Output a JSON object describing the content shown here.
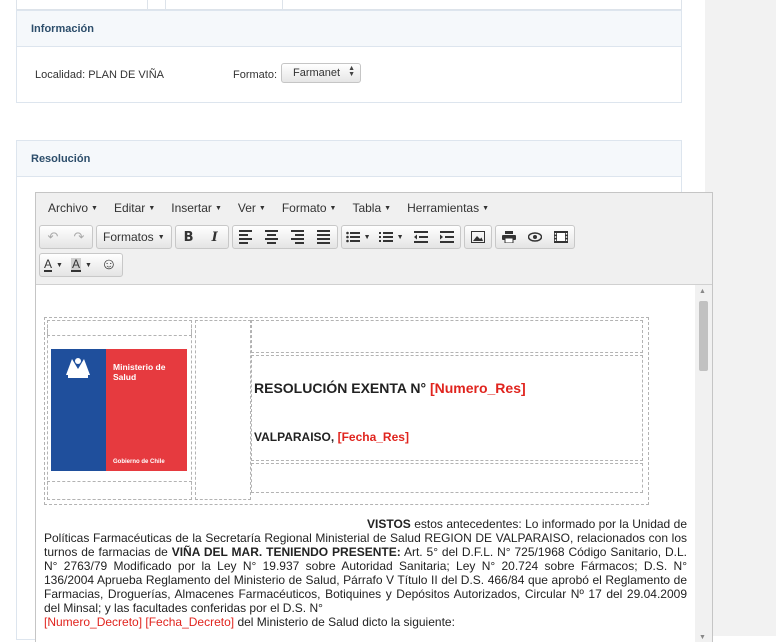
{
  "panels": {
    "informacion": {
      "title": "Información",
      "localidad": "Localidad: PLAN DE VIÑA",
      "formato_label": "Formato:",
      "formato_value": "Farmanet"
    },
    "resolucion": {
      "title": "Resolución"
    }
  },
  "editor": {
    "menu": [
      "Archivo",
      "Editar",
      "Insertar",
      "Ver",
      "Formato",
      "Tabla",
      "Herramientas"
    ],
    "formats_label": "Formatos",
    "icons": [
      "undo-icon",
      "redo-icon",
      "bold-icon",
      "italic-icon",
      "align-left-icon",
      "align-center-icon",
      "align-right-icon",
      "align-justify-icon",
      "bullet-list-icon",
      "numbered-list-icon",
      "outdent-icon",
      "indent-icon",
      "image-icon",
      "print-icon",
      "preview-icon",
      "media-icon",
      "text-color-icon",
      "background-color-icon",
      "emoticons-icon"
    ],
    "glyphs": {
      "undo": "↶",
      "redo": "↷",
      "bold": "B",
      "italic": "I",
      "text_color": "A",
      "bg_color": "A",
      "emoticon": "☺"
    }
  },
  "document": {
    "logo": {
      "ministerio": "Ministerio de Salud",
      "gobierno": "Gobierno de Chile"
    },
    "resolucion_label": "RESOLUCIÓN EXENTA N°",
    "numero_res_placeholder": "[Numero_Res]",
    "city": "VALPARAISO,",
    "fecha_res_placeholder": "[Fecha_Res]",
    "vistos_label": "VISTOS",
    "vistos_text_1": "estos antecedentes: Lo informado por la Unidad de Políticas Farmacéuticas de la Secretaría Regional Ministerial de Salud REGION DE VALPARAISO, relacionados con los turnos de farmacias de",
    "vistos_bold": "VIÑA DEL MAR. TENIENDO PRESENTE:",
    "vistos_text_2": "Art. 5°  del D.F.L. N° 725/1968 Código Sanitario, D.L. N° 2763/79 Modificado por la Ley N° 19.937 sobre Autoridad Sanitaria; Ley N° 20.724 sobre Fármacos; D.S. N° 136/2004 Aprueba Reglamento del Ministerio de Salud, Párrafo V Título II del D.S. 466/84 que aprobó el Reglamento de Farmacias, Droguerías, Almacenes Farmacéuticos, Botiquines y Depósitos Autorizados, Circular Nº 17 del 29.04.2009 del Minsal;  y las facultades conferidas por el D.S. N°",
    "numero_decreto_placeholder": "[Numero_Decreto]",
    "fecha_decreto_placeholder": "[Fecha_Decreto]",
    "vistos_text_3": "del Ministerio de Salud dicto la siguiente:"
  },
  "colors": {
    "panel_title": "#2d4e6b",
    "placeholder_red": "#e0241e",
    "logo_blue": "#1f4f9c",
    "logo_red": "#e63a3f"
  }
}
